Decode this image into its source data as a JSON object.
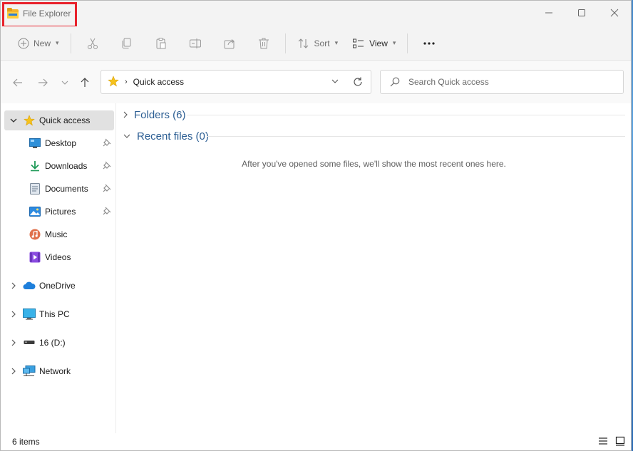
{
  "window": {
    "title": "File Explorer",
    "controls": [
      "minimize",
      "maximize",
      "close"
    ]
  },
  "commandbar": {
    "new_label": "New",
    "sort_label": "Sort",
    "view_label": "View",
    "more_label": "...",
    "icons": [
      "cut-icon",
      "copy-icon",
      "paste-icon",
      "rename-icon",
      "share-icon",
      "delete-icon"
    ]
  },
  "address": {
    "path_label": "Quick access",
    "search_placeholder": "Search Quick access"
  },
  "sidebar": {
    "items": [
      {
        "label": "Quick access",
        "icon": "star-icon",
        "selected": true,
        "expanded": true
      },
      {
        "label": "Desktop",
        "icon": "desktop-icon",
        "pinned": true
      },
      {
        "label": "Downloads",
        "icon": "download-icon",
        "pinned": true
      },
      {
        "label": "Documents",
        "icon": "documents-icon",
        "pinned": true
      },
      {
        "label": "Pictures",
        "icon": "pictures-icon",
        "pinned": true
      },
      {
        "label": "Music",
        "icon": "music-icon"
      },
      {
        "label": "Videos",
        "icon": "videos-icon"
      },
      {
        "label": "OneDrive",
        "icon": "onedrive-icon"
      },
      {
        "label": "This PC",
        "icon": "this-pc-icon"
      },
      {
        "label": "16 (D:)",
        "icon": "drive-icon"
      },
      {
        "label": "Network",
        "icon": "network-icon"
      }
    ]
  },
  "content": {
    "folders_header": "Folders (6)",
    "recent_header": "Recent files (0)",
    "empty_message": "After you've opened some files, we'll show the most recent ones here."
  },
  "status": {
    "item_count": "6 items"
  },
  "colors": {
    "accent_blue": "#2c5e93",
    "highlight_red": "#e8212b",
    "folder_yellow": "#ffcd3c"
  }
}
